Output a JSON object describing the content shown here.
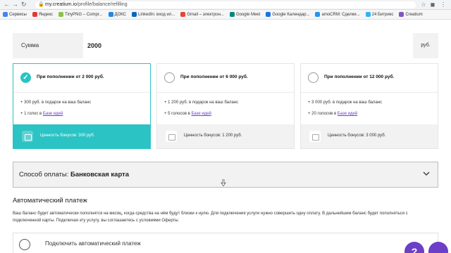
{
  "browser": {
    "url_host": "my.creatium.io",
    "url_path": "/profile/balance/refilling",
    "bookmarks": [
      {
        "label": "Сервисы",
        "color": "#4285f4"
      },
      {
        "label": "Яндекс",
        "color": "#e53935"
      },
      {
        "label": "TinyPNG – Compr...",
        "color": "#8bc34a"
      },
      {
        "label": "ДОКС",
        "color": "#1e88e5"
      },
      {
        "label": "LinkedIn: вход ил...",
        "color": "#0a66c2"
      },
      {
        "label": "Gmail – электрон...",
        "color": "#ea4335"
      },
      {
        "label": "Google Meet",
        "color": "#00897b"
      },
      {
        "label": "Google Календар...",
        "color": "#1a73e8"
      },
      {
        "label": "amoCRM: Сделки...",
        "color": "#2196f3"
      },
      {
        "label": "24 Битрикс",
        "color": "#29b6f6"
      },
      {
        "label": "Creatium",
        "color": "#7e57c2"
      }
    ]
  },
  "amount": {
    "label": "Сумма",
    "value": "2000",
    "currency": "руб."
  },
  "cards": [
    {
      "title": "При пополнении от 2 000 руб.",
      "line1": "+ 300 руб. в подарок на ваш баланс",
      "line2_prefix": "+ 1 голос в ",
      "line2_link": "Базе идей",
      "footer": "Ценность бонусов: 300 руб.",
      "selected": true
    },
    {
      "title": "При пополнении от 6 000 руб.",
      "line1": "+ 1 200 руб. в подарок на ваш баланс",
      "line2_prefix": "+ 5 голосов в ",
      "line2_link": "Базе идей",
      "footer": "Ценность бонусов: 1 200 руб.",
      "selected": false
    },
    {
      "title": "При пополнении от 12 000 руб.",
      "line1": "+ 3 000 руб. в подарок на ваш баланс",
      "line2_prefix": "+ 20 голосов в ",
      "line2_link": "Базе идей",
      "footer": "Ценность бонусов: 3 000 руб.",
      "selected": false
    }
  ],
  "payment": {
    "label": "Способ оплаты: ",
    "value": "Банковская карта"
  },
  "autopay": {
    "heading": "Автоматический платеж",
    "description": "Ваш баланс будет автоматически пополнятся на месяц, когда средства на нём будут близки к нулю. Для подключения услуги нужно совершить одну оплату. В дальнейшем баланс будет пополняться с подключенной карты. Подключая эту услугу, вы соглашаетесь с условиями Оферты.",
    "toggle_label": "Подключить автоматический платеж"
  },
  "help": {
    "label": "?"
  },
  "colors": {
    "accent": "#2bc3c3",
    "brand": "#6c3fc7"
  }
}
